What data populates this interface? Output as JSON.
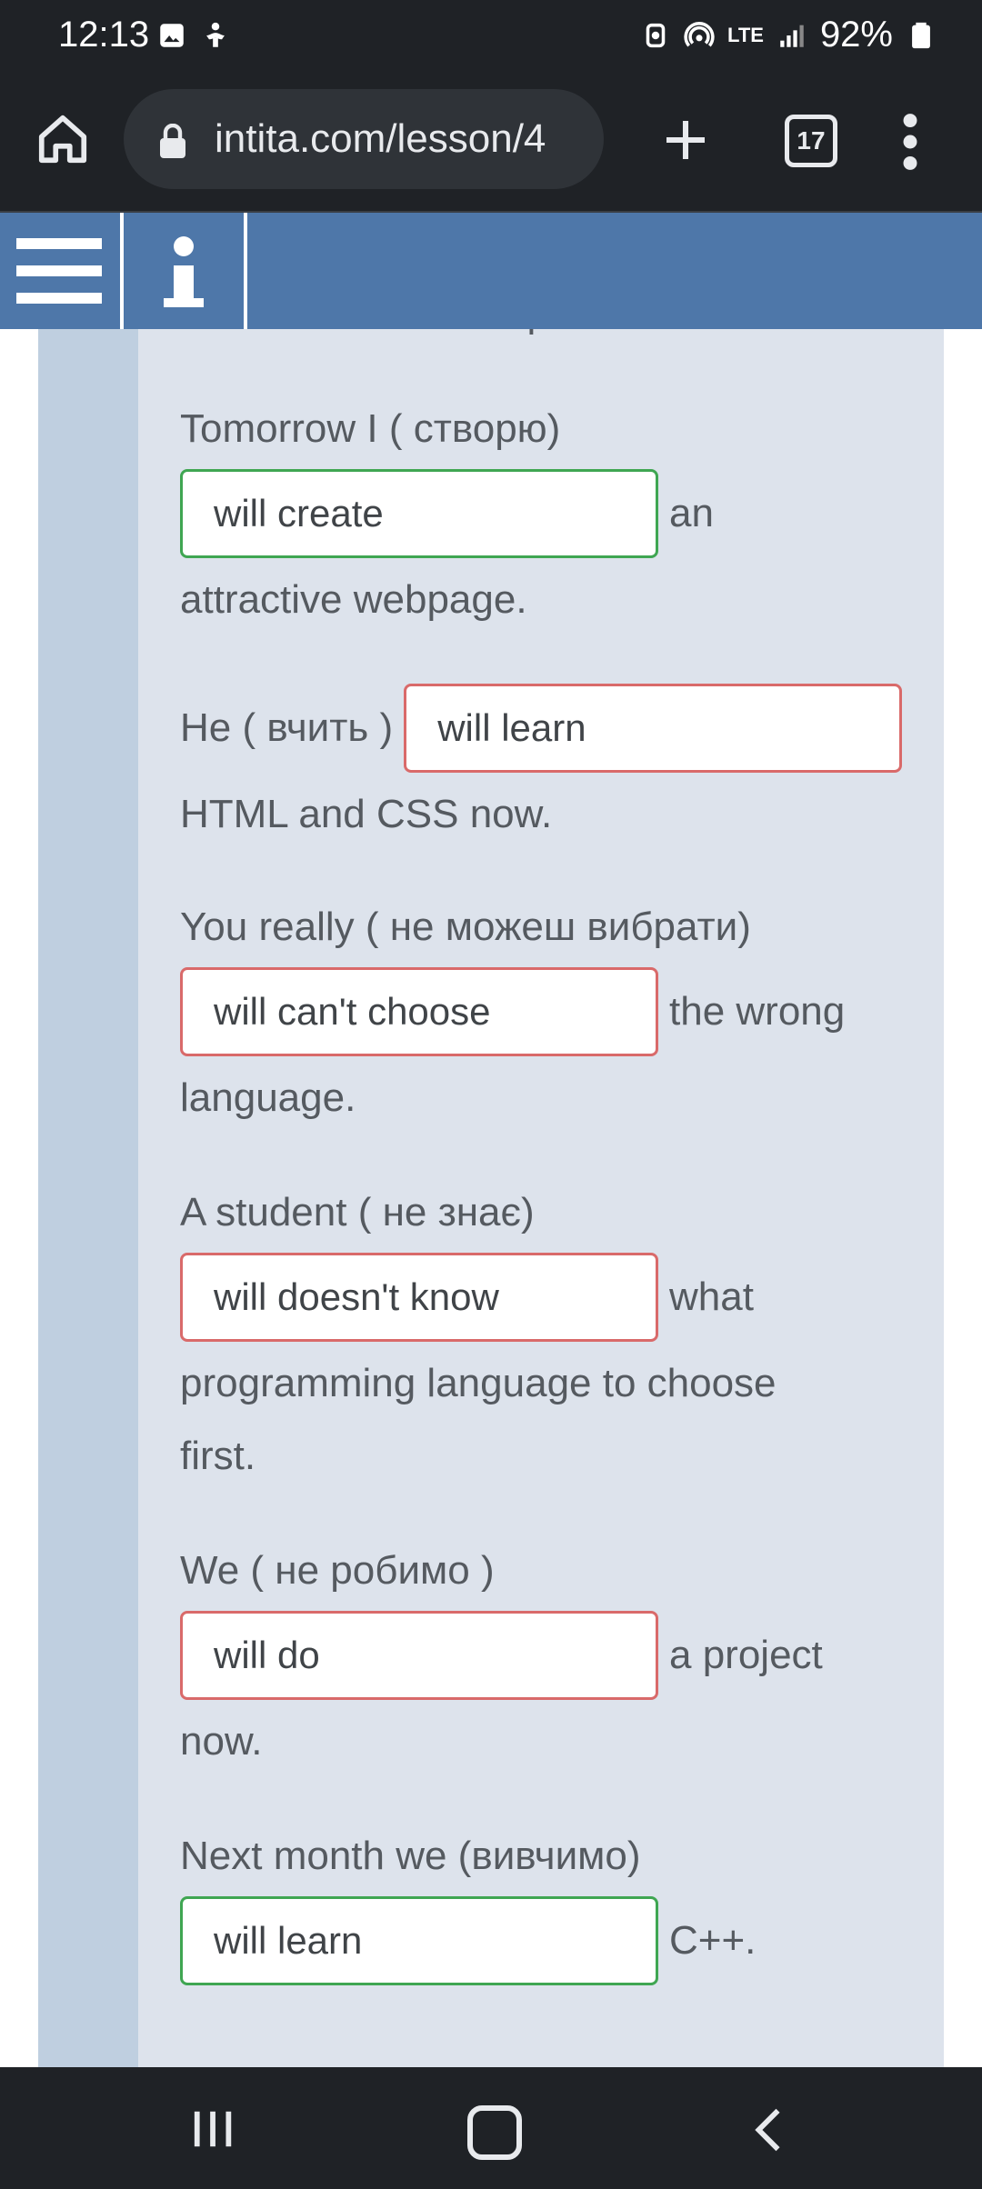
{
  "status_bar": {
    "time": "12:13",
    "battery": "92%",
    "network": "LTE"
  },
  "browser": {
    "url": "intita.com/lesson/4",
    "tab_count": "17",
    "icons": [
      "home-icon",
      "lock-icon",
      "plus-icon",
      "tabs-icon",
      "more-vert-icon"
    ]
  },
  "app_header": {
    "icons": [
      "hamburger-icon",
      "info-icon"
    ]
  },
  "exercise": {
    "cut_off_line": "instructions for computers.",
    "items": [
      {
        "prompt": "Tomorrow I ( створю)",
        "answer": "will create",
        "after": "an",
        "rest": "attractive webpage.",
        "status": "correct"
      },
      {
        "prompt": "He ( вчить )",
        "answer": "will learn",
        "after": "",
        "rest": "HTML and CSS now.",
        "status": "incorrect"
      },
      {
        "prompt": "You really ( не можеш вибрати)",
        "answer": "will can't choose",
        "after": "the wrong",
        "rest": "language.",
        "status": "incorrect"
      },
      {
        "prompt": "A student ( не знає)",
        "answer": "will doesn't know",
        "after": "what",
        "rest": "programming language to choose first.",
        "status": "incorrect"
      },
      {
        "prompt": "We ( не робимо )",
        "answer": "will do",
        "after": "a project",
        "rest": "now.",
        "status": "incorrect"
      },
      {
        "prompt": "Next month we (вивчимо)",
        "answer": "will learn",
        "after": "C++.",
        "rest": "",
        "status": "correct"
      }
    ]
  },
  "colors": {
    "header": "#4e77a9",
    "panel": "#dde3ec",
    "correct_border": "#3fa652",
    "incorrect_border": "#d96a6a"
  }
}
